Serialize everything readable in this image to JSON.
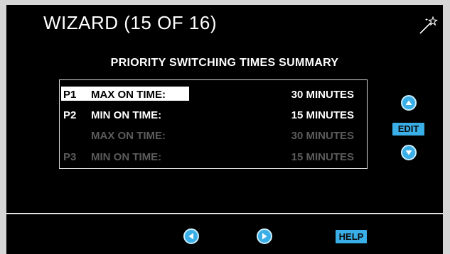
{
  "header": {
    "title": "WIZARD (15 OF 16)",
    "icon": "magic-wand-icon"
  },
  "summary": {
    "title": "PRIORITY SWITCHING TIMES SUMMARY",
    "rows": [
      {
        "priority": "P1",
        "label": "MAX ON TIME:",
        "value": "30 MINUTES",
        "state": "selected"
      },
      {
        "priority": "P2",
        "label": "MIN ON TIME:",
        "value": "15 MINUTES",
        "state": "active"
      },
      {
        "priority": "",
        "label": "MAX ON TIME:",
        "value": "30 MINUTES",
        "state": "disabled"
      },
      {
        "priority": "P3",
        "label": "MIN ON TIME:",
        "value": "15 MINUTES",
        "state": "disabled"
      }
    ]
  },
  "side_controls": {
    "edit_label": "EDIT",
    "up_icon": "arrow-up-icon",
    "down_icon": "arrow-down-icon"
  },
  "footer": {
    "help_label": "HELP",
    "prev_icon": "arrow-left-icon",
    "next_icon": "arrow-right-icon"
  },
  "colors": {
    "accent": "#3aaee6",
    "background": "#000000",
    "disabled_text": "#5b5b5b",
    "frame": "#d6d6d6"
  }
}
